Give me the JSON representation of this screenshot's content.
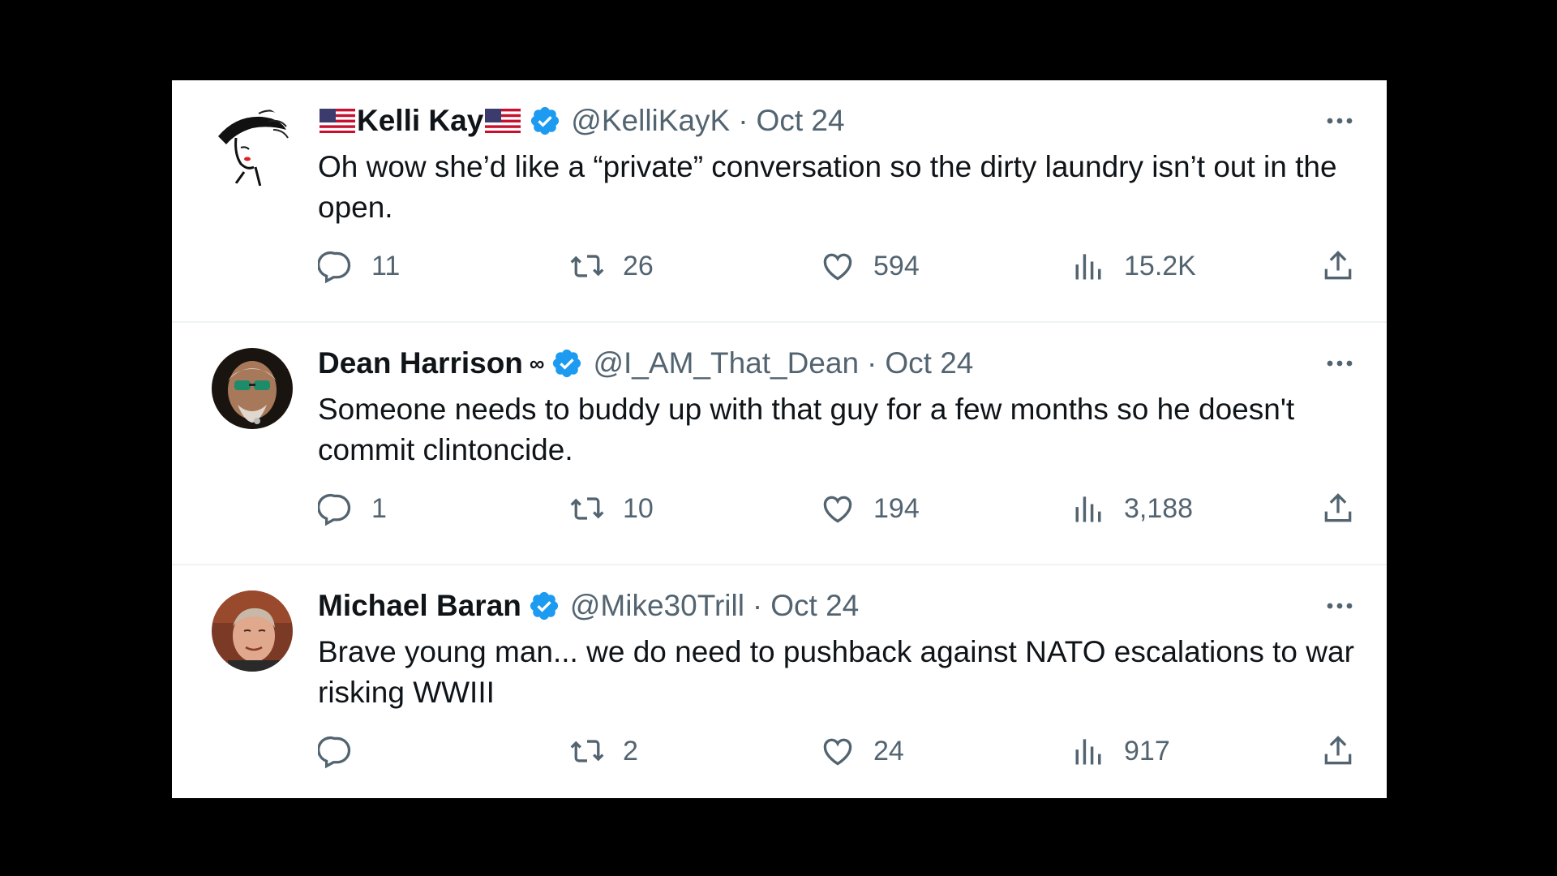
{
  "colors": {
    "verified": "#1d9bf0",
    "muted": "#536471",
    "text": "#0f1419"
  },
  "tweets": [
    {
      "name": "Kelli Kay",
      "handle": "@KelliKayK",
      "separator": "·",
      "date": "Oct 24",
      "text": "Oh wow she’d like a “private” conversation so the dirty laundry isn’t out in the open.",
      "replies": "11",
      "retweets": "26",
      "likes": "594",
      "views": "15.2K"
    },
    {
      "name": "Dean Harrison",
      "name_suffix": "∞",
      "handle": "@I_AM_That_Dean",
      "separator": "·",
      "date": "Oct 24",
      "text": "Someone needs to buddy up with that guy for a few months so he doesn't commit clintoncide.",
      "replies": "1",
      "retweets": "10",
      "likes": "194",
      "views": "3,188"
    },
    {
      "name": "Michael Baran",
      "handle": "@Mike30Trill",
      "separator": "·",
      "date": "Oct 24",
      "text": "Brave young man...  we do need to pushback against NATO escalations to war risking WWIII",
      "replies": "",
      "retweets": "2",
      "likes": "24",
      "views": "917"
    }
  ]
}
